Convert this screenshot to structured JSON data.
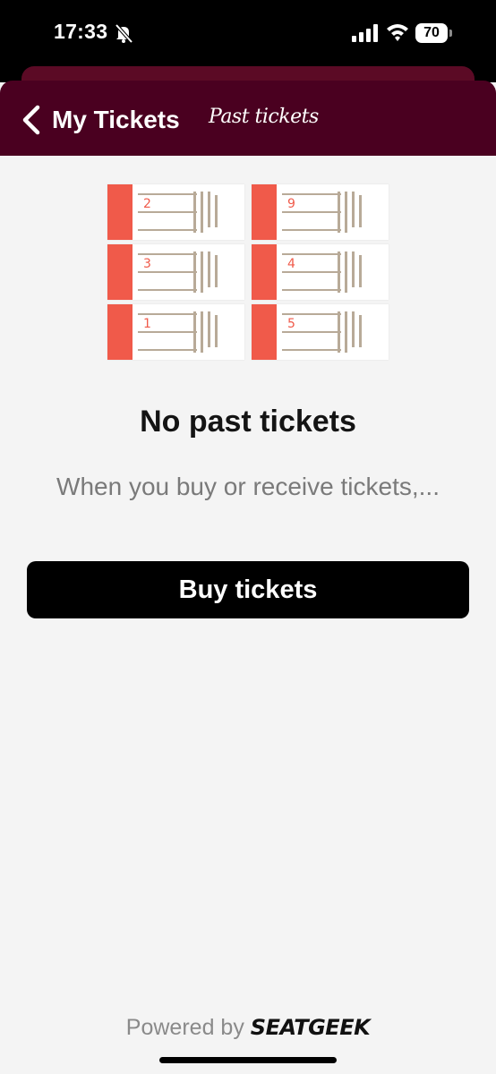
{
  "status_bar": {
    "time": "17:33",
    "battery": "70"
  },
  "header": {
    "title": "My Tickets",
    "tab": "Past tickets"
  },
  "illustration": {
    "tickets": [
      "2",
      "9",
      "3",
      "4",
      "1",
      "5"
    ],
    "stub_color": "#f05a4a"
  },
  "empty_state": {
    "title": "No past tickets",
    "message": "When you buy or receive tickets,..."
  },
  "buy_button": {
    "label": "Buy tickets"
  },
  "footer": {
    "powered_by": "Powered by",
    "brand": "SEATGEEK"
  },
  "colors": {
    "header": "#4a0020",
    "background": "#f4f4f4",
    "button": "#000000"
  }
}
